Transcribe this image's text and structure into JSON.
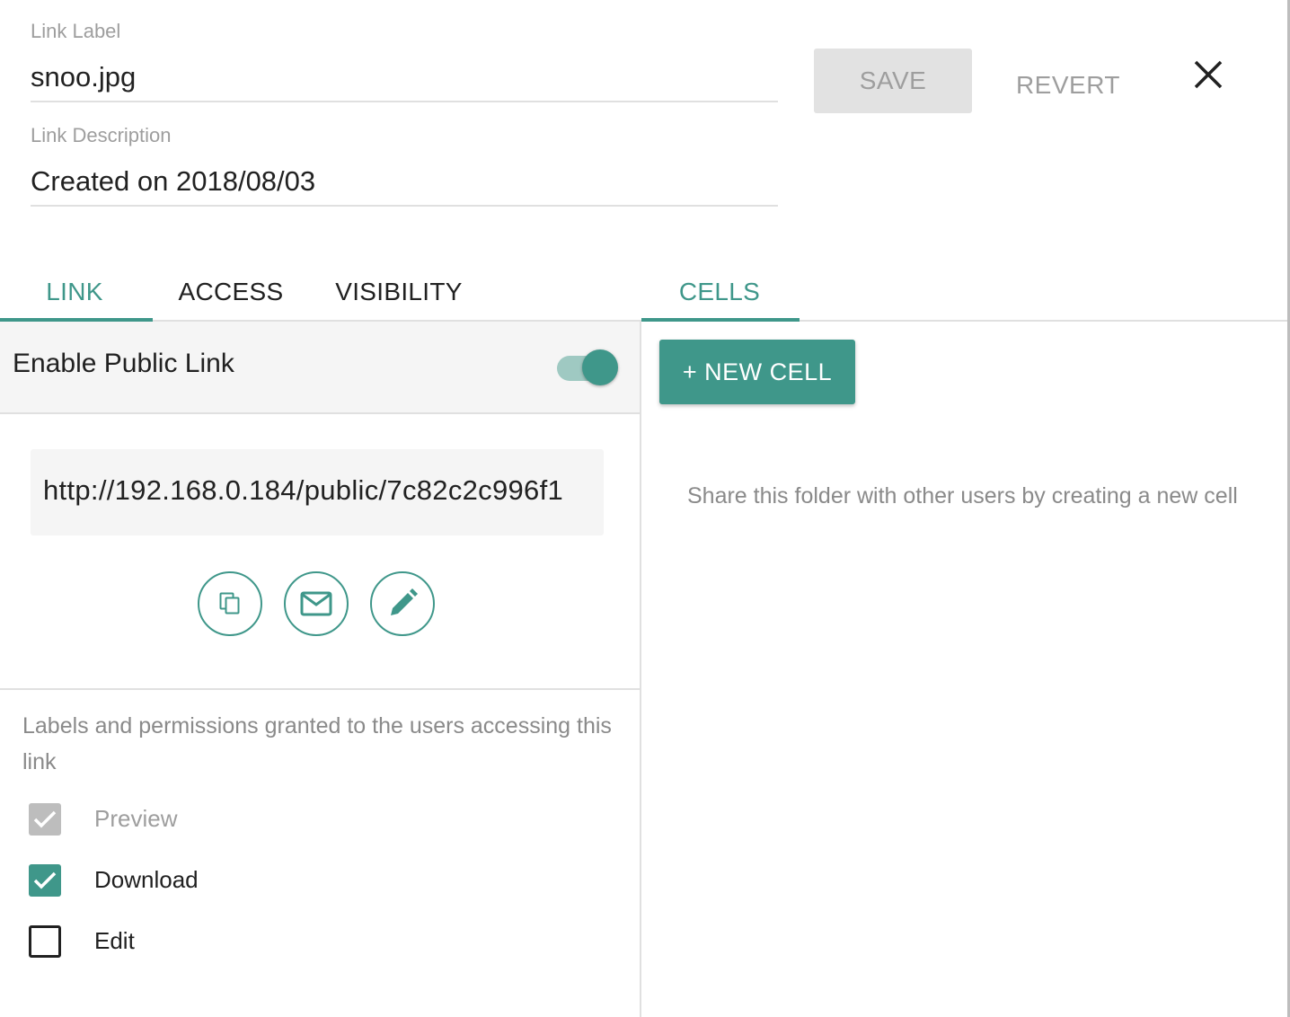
{
  "header": {
    "label_field": {
      "label": "Link Label",
      "value": "snoo.jpg"
    },
    "description_field": {
      "label": "Link Description",
      "value": "Created on 2018/08/03"
    },
    "save_label": "SAVE",
    "revert_label": "REVERT",
    "close_icon": "close-icon"
  },
  "tabs": {
    "left": [
      {
        "label": "LINK",
        "active": true
      },
      {
        "label": "ACCESS",
        "active": false
      },
      {
        "label": "VISIBILITY",
        "active": false
      }
    ],
    "right": [
      {
        "label": "CELLS",
        "active": true
      }
    ]
  },
  "link_panel": {
    "toggle_label": "Enable Public Link",
    "toggle_on": true,
    "url": "http://192.168.0.184/public/7c82c2c996f1",
    "actions": [
      {
        "icon": "copy-icon"
      },
      {
        "icon": "mail-icon"
      },
      {
        "icon": "pencil-icon"
      }
    ],
    "permissions_text": "Labels and permissions granted to the users accessing this link",
    "permissions": [
      {
        "label": "Preview",
        "checked": true,
        "disabled": true
      },
      {
        "label": "Download",
        "checked": true,
        "disabled": false
      },
      {
        "label": "Edit",
        "checked": false,
        "disabled": false
      }
    ]
  },
  "cells_panel": {
    "new_cell_label": "+ NEW CELL",
    "empty_text": "Share this folder with other users by creating a new cell"
  },
  "colors": {
    "accent": "#3f978a",
    "muted_text": "#9e9e9e",
    "divider": "#e0e0e0",
    "panel_bg": "#f5f5f5"
  }
}
